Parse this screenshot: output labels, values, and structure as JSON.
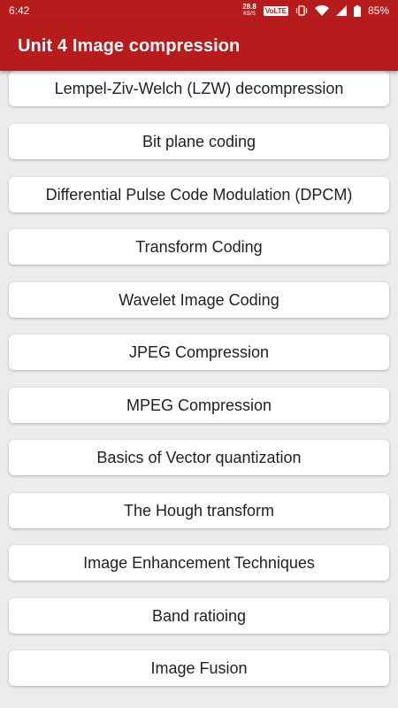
{
  "status_bar": {
    "time": "6:42",
    "net_speed_value": "28.8",
    "net_speed_unit": "KB/S",
    "volte_label": "VoLTE",
    "battery_percent": "85%",
    "icons": [
      "vibrate-icon",
      "wifi-icon",
      "signal-icon",
      "battery-icon"
    ]
  },
  "app_bar": {
    "title": "Unit 4 Image compression"
  },
  "topics": [
    "Lempel-Ziv-Welch (LZW) decompression",
    "Bit plane coding",
    "Differential Pulse Code Modulation (DPCM)",
    "Transform Coding",
    "Wavelet Image Coding",
    "JPEG Compression",
    "MPEG Compression",
    "Basics of Vector quantization",
    "The Hough transform",
    "Image Enhancement Techniques",
    "Band ratioing",
    "Image Fusion"
  ],
  "colors": {
    "primary": "#b71c1c",
    "background": "#ececec",
    "card": "#ffffff"
  }
}
